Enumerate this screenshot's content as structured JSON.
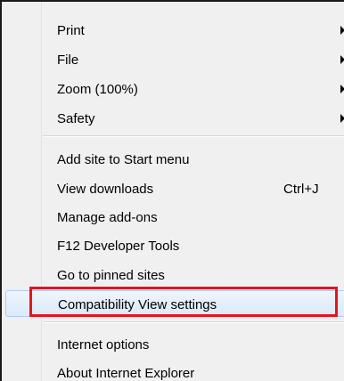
{
  "menu": {
    "group1": [
      {
        "label": "Print",
        "has_submenu": true
      },
      {
        "label": "File",
        "has_submenu": true
      },
      {
        "label": "Zoom (100%)",
        "has_submenu": true
      },
      {
        "label": "Safety",
        "has_submenu": true
      }
    ],
    "group2": [
      {
        "label": "Add site to Start menu"
      },
      {
        "label": "View downloads",
        "shortcut": "Ctrl+J"
      },
      {
        "label": "Manage add-ons"
      },
      {
        "label": "F12 Developer Tools"
      },
      {
        "label": "Go to pinned sites"
      },
      {
        "label": "Compatibility View settings",
        "highlighted": true
      }
    ],
    "group3": [
      {
        "label": "Internet options"
      },
      {
        "label": "About Internet Explorer"
      }
    ]
  },
  "colors": {
    "menu_background": "#f0f0f0",
    "hover_border": "#aecbf1",
    "annotation_red": "#e8141b"
  },
  "icons": {
    "submenu_arrow": "triangle-right"
  }
}
